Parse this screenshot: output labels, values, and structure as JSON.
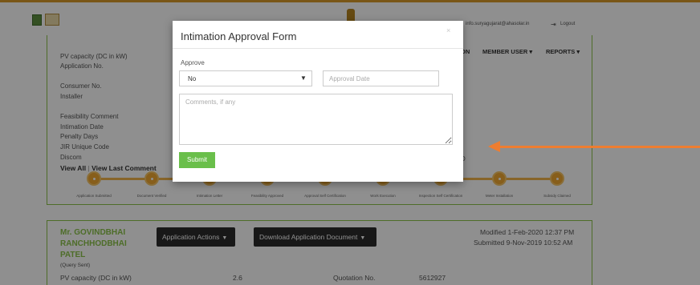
{
  "header": {
    "user_email": "info.suryagujarat@ahasolar.in",
    "logout_label": "Logout"
  },
  "menu": {
    "item_partial": "ON",
    "member_user": "MEMBER USER ▾",
    "reports": "REPORTS ▾"
  },
  "application": {
    "fields": [
      "PV capacity (DC in kW)",
      "Application No.",
      "Consumer No.",
      "Installer",
      "Feasibility Comment",
      "Intimation Date",
      "Penalty Days",
      "JIR Unique Code",
      "Discom"
    ],
    "view_all": "View All",
    "separator": "|",
    "view_last_comment": "View Last Comment",
    "partial_value": "D"
  },
  "progress_steps": [
    "Application Submitted",
    "Document Verified",
    "Intimation Letter",
    "Feasibility Approved",
    "Approval Self Certification",
    "Work Execution",
    "Inspection Self Certification",
    "Meter Installation",
    "Subsidy Claimed"
  ],
  "second_app": {
    "applicant": "Mr. GOVINDBHAI RANCHHODBHAI PATEL",
    "status": "(Query Sent)",
    "actions_label": "Application Actions",
    "download_label": "Download Application Document",
    "modified": "Modified 1-Feb-2020 12:37 PM",
    "submitted": "Submitted 9-Nov-2019 10:52 AM",
    "pv_label": "PV capacity (DC in kW)",
    "pv_value": "2.6",
    "quotation_label": "Quotation No.",
    "quotation_value": "5612927"
  },
  "modal": {
    "title": "Intimation Approval Form",
    "close_label": "×",
    "approve_label": "Approve",
    "approve_value": "No",
    "approval_date_placeholder": "Approval Date",
    "comments_placeholder": "Comments, if any",
    "submit_label": "Submit"
  },
  "colors": {
    "accent_green": "#6abf4b",
    "progress_orange": "#f0a830",
    "annotation_arrow": "#ee7d30"
  }
}
